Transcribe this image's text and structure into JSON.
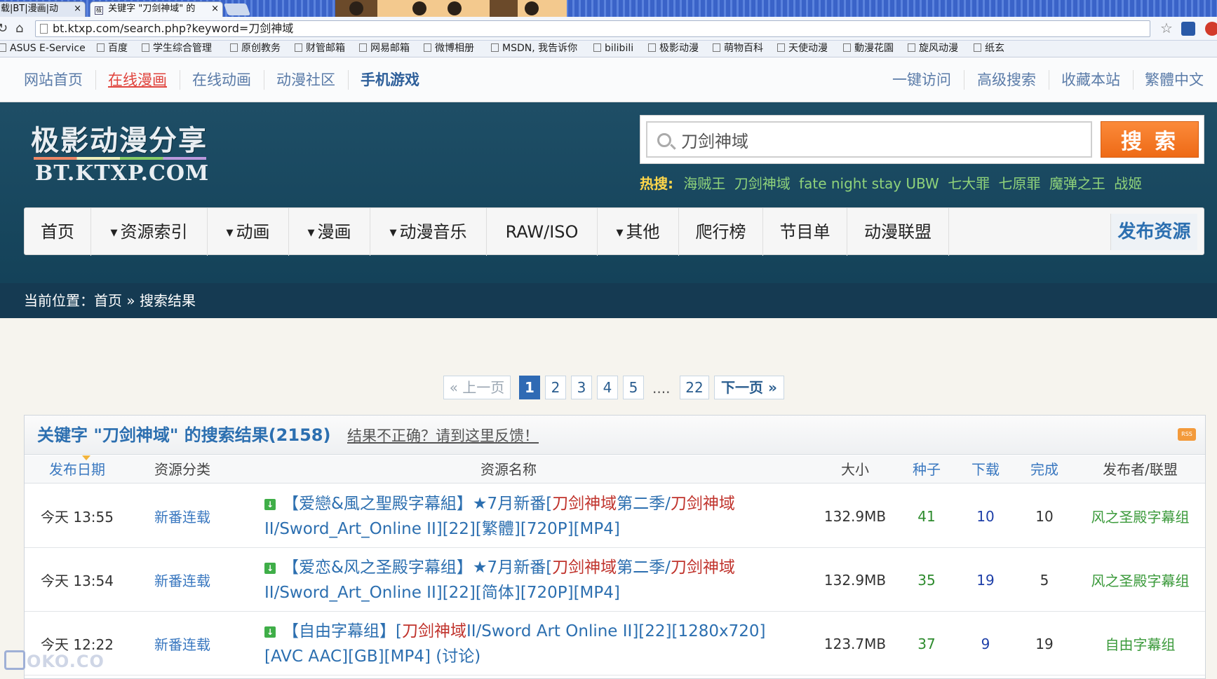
{
  "browser": {
    "tabs": [
      {
        "label": "载|BT|漫画|动"
      },
      {
        "label": "关键字 \"刀剑神域\" 的"
      }
    ],
    "url": "bt.ktxp.com/search.php?keyword=刀剑神域",
    "bookmarks": [
      "ASUS E-Service",
      "百度",
      "学生综合管理",
      "原创教务",
      "财管邮箱",
      "网易邮箱",
      "微博相册",
      "MSDN, 我告诉你",
      "bilibili",
      "极影动漫",
      "萌物百科",
      "天使动漫",
      "動漫花園",
      "旋风动漫",
      "纸玄"
    ]
  },
  "topnav": {
    "left": [
      "网站首页",
      "在线漫画",
      "在线动画",
      "动漫社区",
      "手机游戏"
    ],
    "right": [
      "一键访问",
      "高级搜索",
      "收藏本站",
      "繁體中文"
    ]
  },
  "logo": {
    "cn": "极影动漫分享",
    "en": "BT.KTXP.COM"
  },
  "search": {
    "value": "刀剑神域",
    "button": "搜索"
  },
  "hot": {
    "label": "热搜:",
    "words": [
      "海贼王",
      "刀剑神域",
      "fate night stay UBW",
      "七大罪",
      "七原罪",
      "魔弹之王",
      "战姬"
    ]
  },
  "mainnav": {
    "items": [
      "首页",
      "资源索引",
      "动画",
      "漫画",
      "动漫音乐",
      "RAW/ISO",
      "其他",
      "爬行榜",
      "节目单",
      "动漫联盟"
    ],
    "publish": "发布资源"
  },
  "breadcrumb": "当前位置：首页 » 搜索结果",
  "pager": {
    "prev": "« 上一页",
    "pages": [
      "1",
      "2",
      "3",
      "4",
      "5"
    ],
    "dots": "....",
    "last": "22",
    "next": "下一页 »",
    "current": "1"
  },
  "results": {
    "title": "关键字 \"刀剑神域\" 的搜索结果(2158)",
    "feedback": "结果不正确？请到这里反馈！",
    "columns": [
      "发布日期",
      "资源分类",
      "资源名称",
      "大小",
      "种子",
      "下载",
      "完成",
      "发布者/联盟"
    ],
    "rows": [
      {
        "date": "今天 13:55",
        "category": "新番连载",
        "name_prefix": "【爱戀&風之聖殿字幕組】★7月新番[",
        "name_hl1": "刀剑神域",
        "name_mid": "第二季/",
        "name_hl2": "刀剑神域",
        "name_suffix": "II/Sword_Art_Online II][22][繁體][720P][MP4]",
        "size": "132.9MB",
        "seeds": "41",
        "downloads": "10",
        "completed": "10",
        "publisher": "风之圣殿字幕组"
      },
      {
        "date": "今天 13:54",
        "category": "新番连载",
        "name_prefix": "【爱恋&风之圣殿字幕组】★7月新番[",
        "name_hl1": "刀剑神域",
        "name_mid": "第二季/",
        "name_hl2": "刀剑神域",
        "name_suffix": "II/Sword_Art_Online II][22][简体][720P][MP4]",
        "size": "132.9MB",
        "seeds": "35",
        "downloads": "19",
        "completed": "5",
        "publisher": "风之圣殿字幕组"
      },
      {
        "date": "今天 12:22",
        "category": "新番连载",
        "name_prefix": "【自由字幕组】[",
        "name_hl1": "刀剑神域",
        "name_mid": "II/Sword Art Online II][22][1280x720]",
        "name_hl2": "",
        "name_suffix": "[AVC AAC][GB][MP4] (讨论)",
        "size": "123.7MB",
        "seeds": "37",
        "downloads": "9",
        "completed": "19",
        "publisher": "自由字幕组"
      }
    ]
  },
  "watermark": "OKO.CO"
}
